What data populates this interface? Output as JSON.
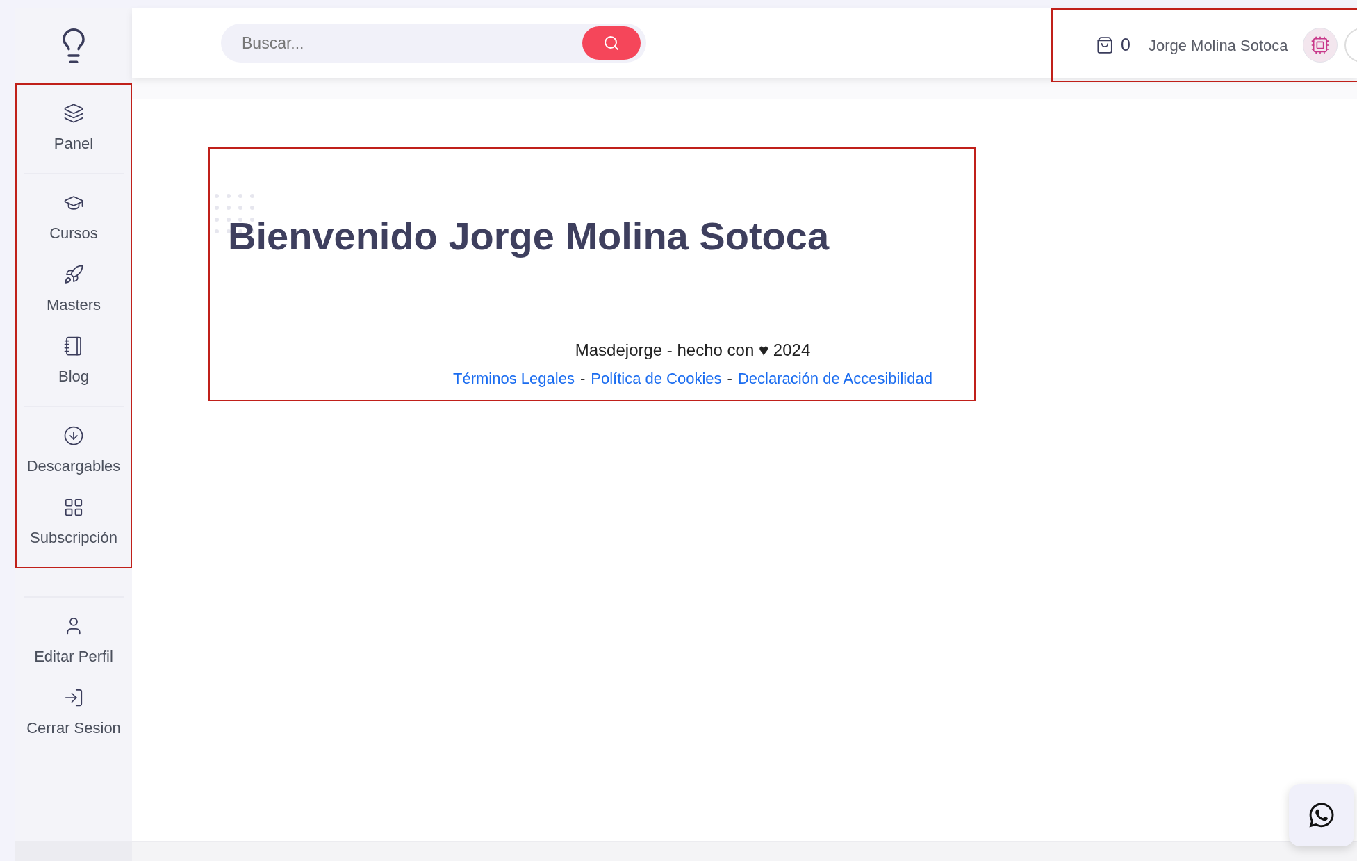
{
  "sidebar": {
    "sections": [
      {
        "items": [
          {
            "label": "Panel"
          }
        ]
      },
      {
        "items": [
          {
            "label": "Cursos"
          },
          {
            "label": "Masters"
          },
          {
            "label": "Blog"
          }
        ]
      },
      {
        "items": [
          {
            "label": "Descargables"
          },
          {
            "label": "Subscripción"
          }
        ]
      },
      {
        "items": [
          {
            "label": "Editar Perfil"
          },
          {
            "label": "Cerrar Sesion"
          }
        ]
      }
    ]
  },
  "header": {
    "search": {
      "placeholder": "Buscar..."
    },
    "cart_count": "0",
    "user_name": "Jorge Molina Sotoca"
  },
  "main": {
    "heading": "Bienvenido Jorge Molina Sotoca",
    "footer_text": "Masdejorge - hecho con ♥ 2024",
    "links": [
      {
        "label": "Términos Legales"
      },
      {
        "label": "Política de Cookies"
      },
      {
        "label": "Declaración de Accesibilidad"
      }
    ],
    "separator": "-"
  }
}
